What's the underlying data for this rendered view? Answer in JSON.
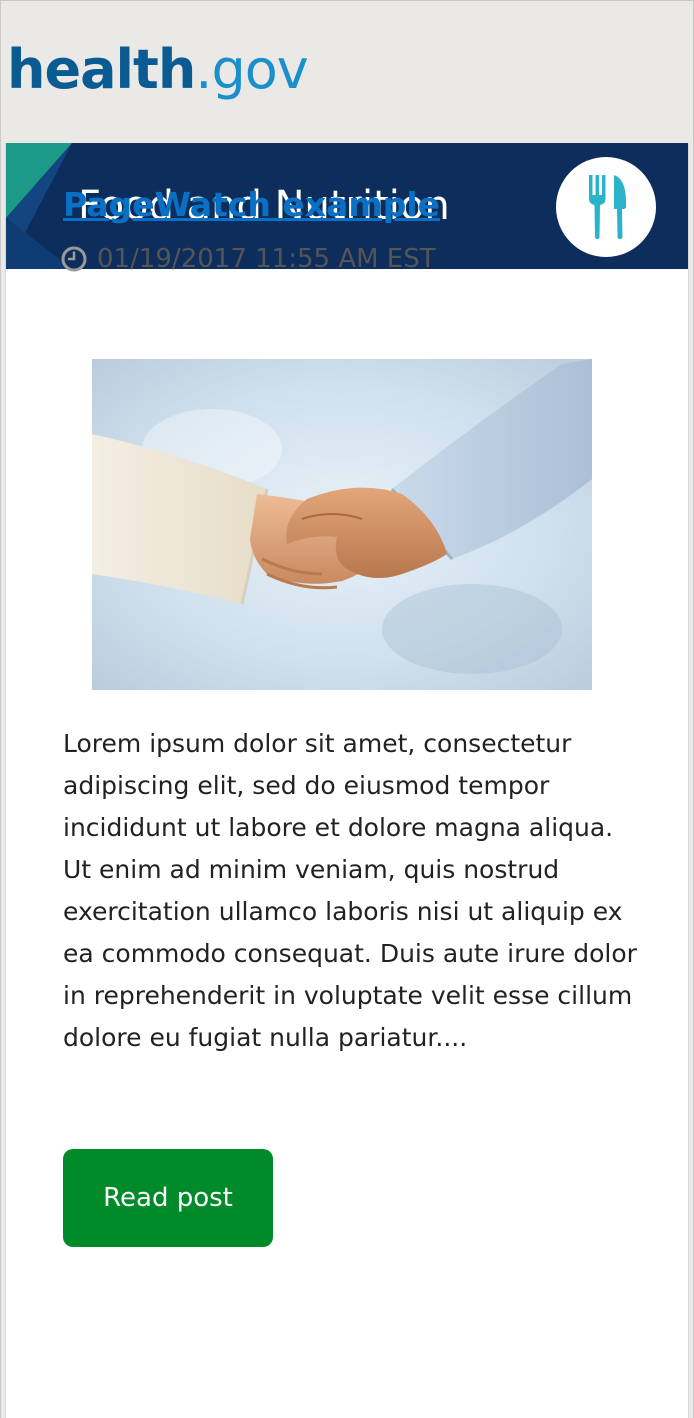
{
  "site": {
    "logo_part1": "health",
    "logo_part2": ".gov",
    "logo_primary_color": "#0b5b93",
    "logo_accent_color": "#1a8fcc"
  },
  "banner": {
    "title": "Food and Nutrition",
    "icon": "fork-knife-icon",
    "background_color": "#0d2e5c",
    "icon_color": "#2bb3c9"
  },
  "post": {
    "title": "PageWatch example",
    "timestamp": "01/19/2017 11:55 AM EST",
    "timestamp_icon": "clock-icon",
    "image_alt": "handshake-photo",
    "body": "Lorem ipsum dolor sit amet, consectetur adipiscing elit, sed do eiusmod tempor incididunt ut labore et dolore magna aliqua. Ut enim ad minim veniam, quis nostrud exercitation ullamco laboris nisi ut aliquip ex ea commodo consequat. Duis aute irure dolor in reprehenderit in voluptate velit esse cillum dolore eu fugiat nulla pariatur....",
    "read_button_label": "Read post",
    "read_button_color": "#008a2a",
    "link_color": "#0a70c3"
  }
}
